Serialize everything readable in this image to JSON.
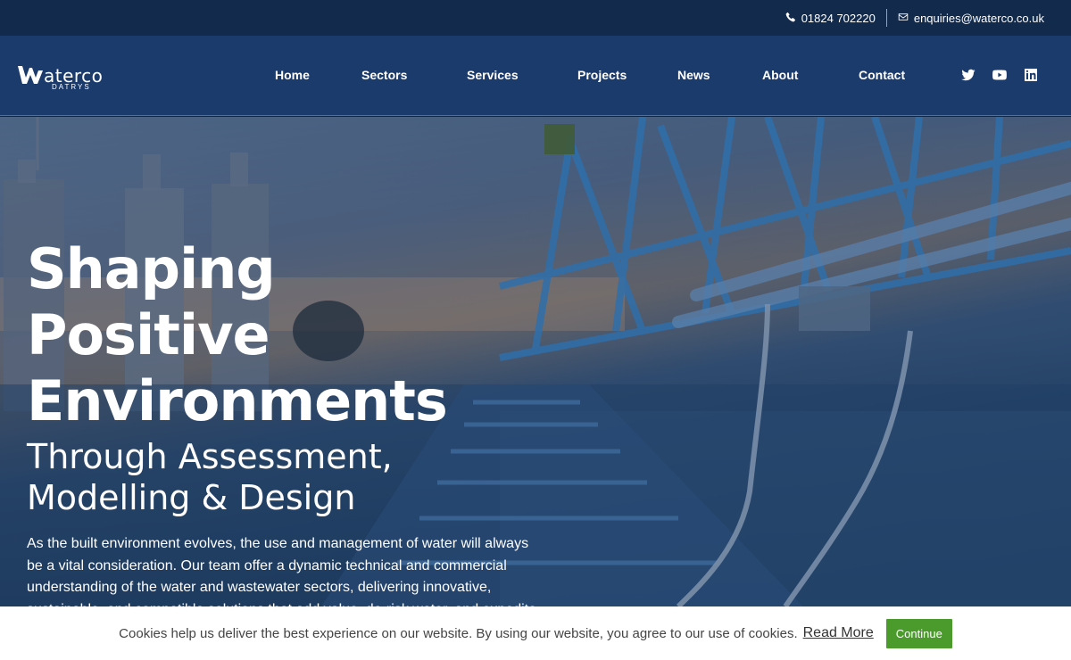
{
  "topbar": {
    "phone": "01824 702220",
    "email": "enquiries@waterco.co.uk",
    "phone_icon": "phone-icon",
    "email_icon": "envelope-icon"
  },
  "nav": {
    "logo_text": "aterco",
    "logo_sub": "DATRYS",
    "items": [
      "Home",
      "Sectors",
      "Services",
      "Projects",
      "News",
      "About",
      "Contact"
    ],
    "socials": [
      "twitter-icon",
      "youtube-icon",
      "linkedin-icon"
    ]
  },
  "hero": {
    "title_line1": "Shaping",
    "title_line2": "Positive",
    "title_line3": "Environments",
    "subtitle_line1": "Through Assessment,",
    "subtitle_line2": "Modelling & Design",
    "body_line1": "As the built environment evolves, the use and management of water will always",
    "body_line2": "be a vital consideration. Our team offer a dynamic technical and commercial",
    "body_line3": "understanding of the water and wastewater sectors, delivering innovative,",
    "body_line4": "sustainable, and compatible solutions that add value, de-risk water, and expedite"
  },
  "cookie": {
    "text": "Cookies help us deliver the best experience on our website. By using our website, you agree to our use of cookies.",
    "read_more": "Read More",
    "continue": "Continue"
  },
  "colors": {
    "topbar": "#122a4c",
    "nav": "#1b3b6c",
    "cookie_button": "#4b9a2c"
  }
}
